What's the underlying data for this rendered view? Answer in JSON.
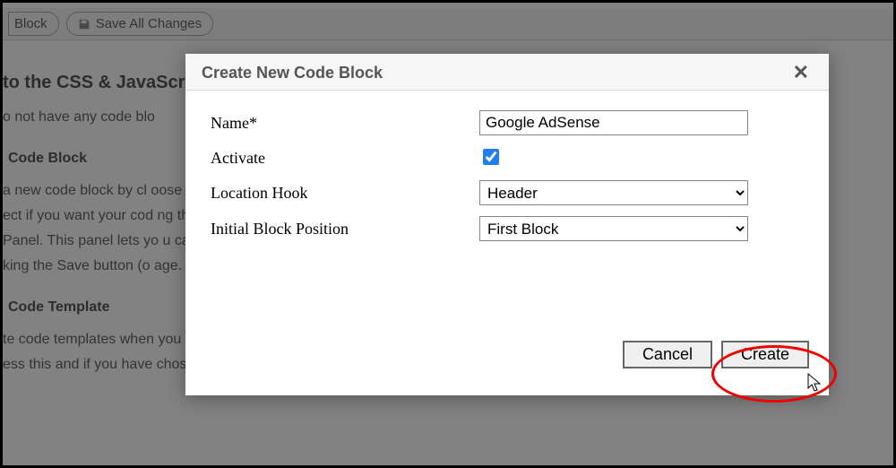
{
  "bg": {
    "toolbar": {
      "block_btn": "Block",
      "save_all_btn": "Save All Changes"
    },
    "heading": "to the CSS & JavaScr",
    "noblocks": "o not have any code blo",
    "sub1": "Code Block",
    "para1": "a new code block by cl                                                                                                                                                                                oose the",
    "para1b": "ect if you want your cod                                                                                                                                                                                      ng the we",
    "para1c": "Panel. This panel lets yo                                                                                                                                                                                       u can sele",
    "para1d": "king the Save button (o                                                                                                                                                                                  age.",
    "sub2": "Code Template",
    "para2": "te code templates when you click into the Code Template Manager. To find this, hover over the icon showing a small",
    "para2b": "ess this and if you have chosen to install the Template Samples, you will notice them sitting in there ready to be used"
  },
  "modal": {
    "title": "Create New Code Block",
    "labels": {
      "name": "Name*",
      "activate": "Activate",
      "hook": "Location Hook",
      "position": "Initial Block Position"
    },
    "values": {
      "name": "Google AdSense",
      "activate": true,
      "hook": "Header",
      "position": "First Block"
    },
    "buttons": {
      "cancel": "Cancel",
      "create": "Create"
    }
  }
}
